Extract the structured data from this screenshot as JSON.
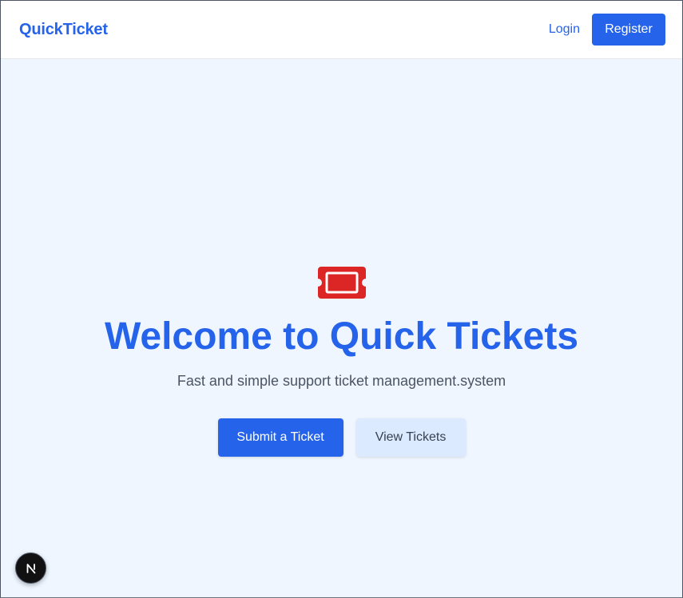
{
  "brand": "QuickTicket",
  "nav": {
    "login_label": "Login",
    "register_label": "Register"
  },
  "hero": {
    "icon": "ticket-icon",
    "title": "Welcome to Quick Tickets",
    "subtitle": "Fast and simple support ticket management.system",
    "primary_action": "Submit a Ticket",
    "secondary_action": "View Tickets"
  },
  "dev_badge": {
    "icon": "nextjs-logo-icon"
  },
  "colors": {
    "accent": "#2563eb",
    "background": "#eff6ff",
    "icon_red": "#dc2626",
    "secondary_button": "#dbeafe"
  }
}
